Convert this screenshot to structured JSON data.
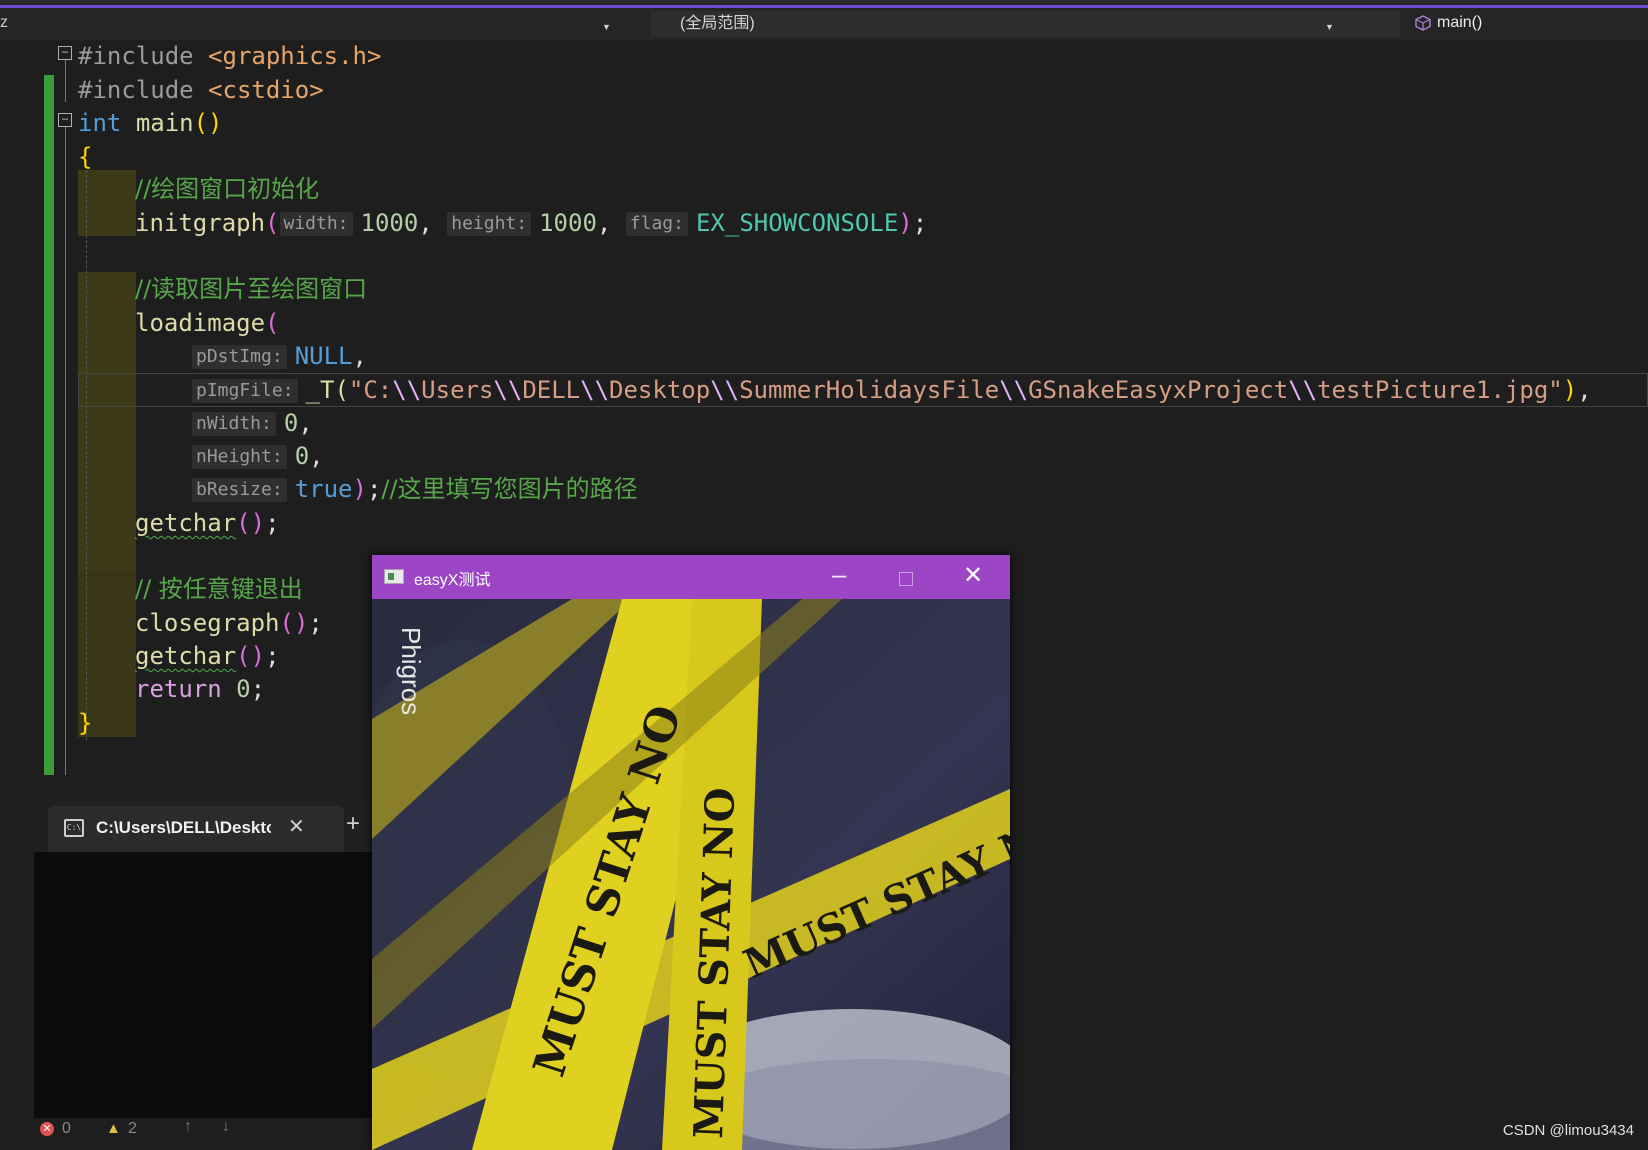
{
  "navbar": {
    "left_fragment": "z",
    "scope_label": "(全局范围)",
    "function_label": "main()"
  },
  "code": {
    "line1": {
      "directive": "#include",
      "header": "<graphics.h>"
    },
    "line2": {
      "directive": "#include",
      "header": "<cstdio>"
    },
    "line3": {
      "type": "int",
      "name": "main",
      "parens": "()"
    },
    "open_brace": "{",
    "comment1": "//绘图窗口初始化",
    "initgraph": {
      "fn": "initgraph",
      "hint_width": "width:",
      "val_width": "1000",
      "hint_height": "height:",
      "val_height": "1000",
      "hint_flag": "flag:",
      "val_flag": "EX_SHOWCONSOLE"
    },
    "comment2": "//读取图片至绘图窗口",
    "loadimage": "loadimage",
    "params": {
      "p1_hint": "pDstImg:",
      "p1_val": "NULL",
      "p2_hint": "pImgFile:",
      "p2_prefix": "_T(",
      "p2_parts": [
        "\"C:",
        "\\\\",
        "Users",
        "\\\\",
        "DELL",
        "\\\\",
        "Desktop",
        "\\\\",
        "SummerHolidaysFile",
        "\\\\",
        "GSnakeEasyxProject",
        "\\\\",
        "testPicture1.jpg\""
      ],
      "p3_hint": "nWidth:",
      "p3_val": "0",
      "p4_hint": "nHeight:",
      "p4_val": "0",
      "p5_hint": "bResize:",
      "p5_val": "true",
      "p5_comment": "//这里填写您图片的路径"
    },
    "getchar": "getchar",
    "comment3": "// 按任意键退出",
    "closegraph": "closegraph",
    "return_kw": "return",
    "return_val": "0",
    "close_brace": "}"
  },
  "terminal": {
    "tab_title": "C:\\Users\\DELL\\Desktop",
    "icon_text": "C:\\"
  },
  "easyx_window": {
    "title": "easyX测试",
    "image_text": {
      "brand": "Phigros",
      "tape_text": "MUST STAY NO"
    }
  },
  "statusbar": {
    "errors": "0",
    "warnings": "2",
    "watermark": "CSDN @limou3434"
  },
  "colors": {
    "accent": "#6f4dd1",
    "easyx_titlebar": "#9c46c6",
    "change_bar": "#3c9c38",
    "tape_yellow": "#d8c81f"
  }
}
